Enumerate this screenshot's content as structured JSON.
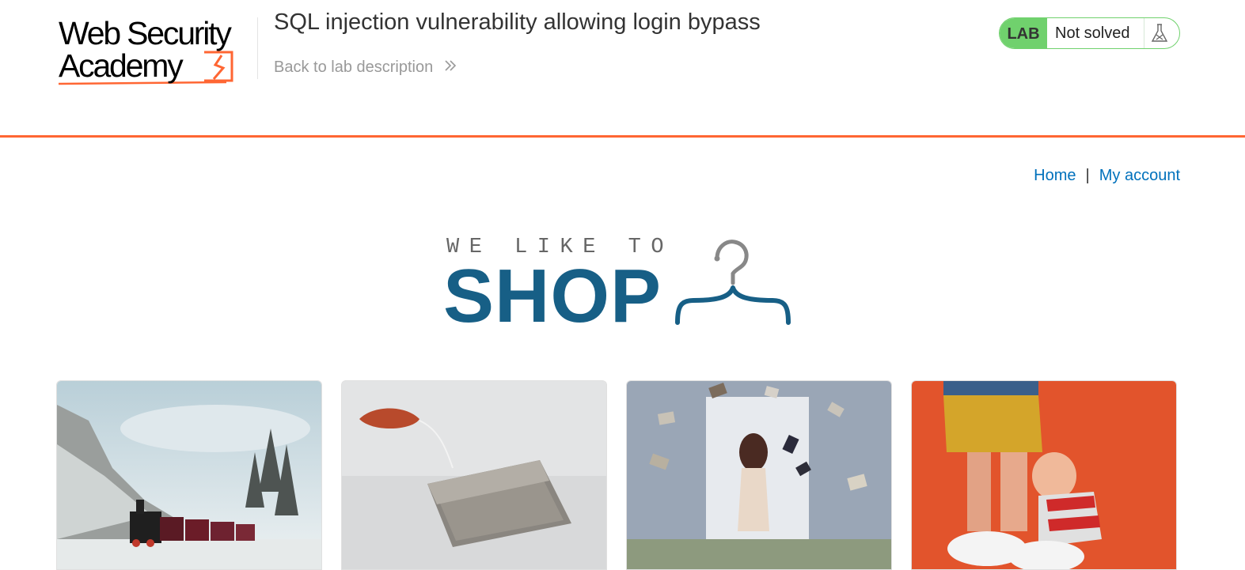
{
  "header": {
    "logo_line1": "Web Security",
    "logo_line2": "Academy",
    "lab_title": "SQL injection vulnerability allowing login bypass",
    "back_link": "Back to lab description",
    "back_icon": "double-chevron-right-icon",
    "lab_badge": "LAB",
    "status": "Not solved",
    "status_icon": "flask-icon",
    "accent_color": "#ff6633",
    "solved_color": "#70d16d"
  },
  "nav": {
    "home": "Home",
    "separator": "|",
    "account": "My account",
    "link_color": "#0071bc"
  },
  "banner": {
    "tagline": "WE LIKE TO",
    "word": "SHOP",
    "icon": "clothes-hanger-icon",
    "color": "#175f86"
  },
  "products": [
    {
      "image": "snowy-forest-steam-train-photo"
    },
    {
      "image": "tea-bag-photo"
    },
    {
      "image": "woman-with-flying-books-photo"
    },
    {
      "image": "cartoon-figurine-orange-background-photo"
    }
  ]
}
